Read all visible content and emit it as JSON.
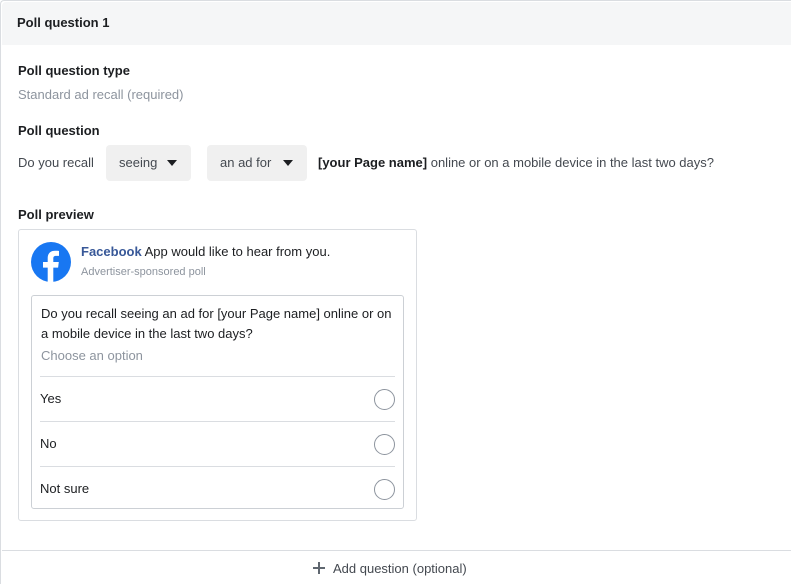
{
  "section": {
    "title": "Poll question 1"
  },
  "question_type": {
    "label": "Poll question type",
    "value": "Standard ad recall (required)"
  },
  "question": {
    "label": "Poll question",
    "prefix": "Do you recall",
    "dropdown_verb": "seeing",
    "dropdown_object": "an ad for",
    "page_name": "[your Page name]",
    "suffix": "online or on a mobile device in the last two days?"
  },
  "preview": {
    "label": "Poll preview",
    "brand_name": "Facebook",
    "brand_message": "App would like to hear from you.",
    "sponsor_text": "Advertiser-sponsored poll",
    "poll_question": "Do you recall seeing an ad for [your Page name] online or on a mobile device in the last two days?",
    "choose_text": "Choose an option",
    "options": [
      "Yes",
      "No",
      "Not sure"
    ],
    "brand_color": "#1877f2"
  },
  "footer": {
    "add_question": "Add question (optional)"
  },
  "icons": {
    "dropdown": "caret-down-icon",
    "logo": "facebook-logo-icon",
    "add": "plus-icon",
    "radio": "radio-button-icon"
  }
}
